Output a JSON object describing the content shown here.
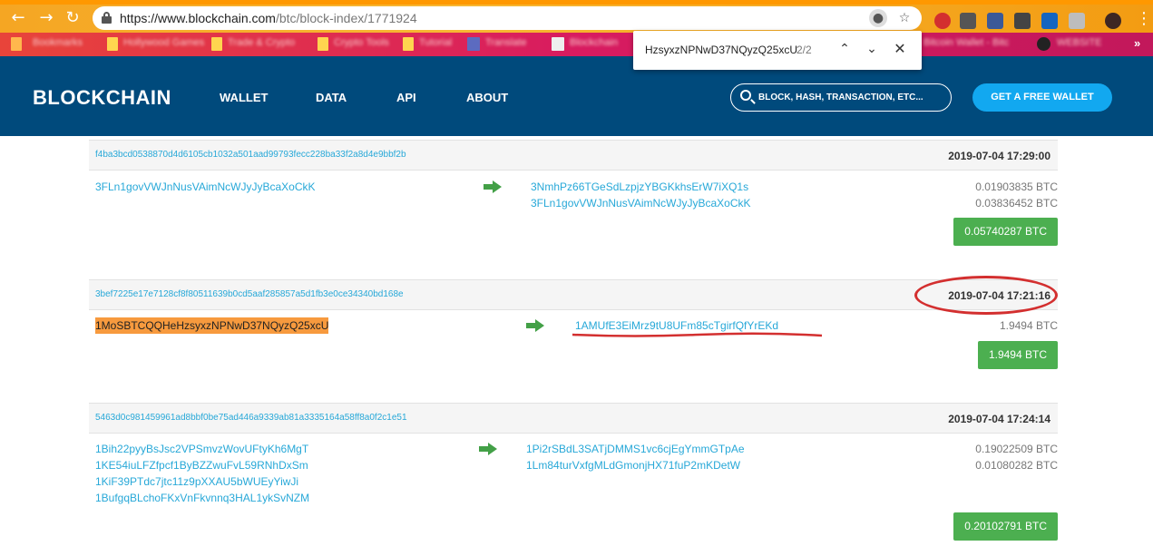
{
  "browser": {
    "url_main": "https://www.blockchain.com",
    "url_path": "/btc/block-index/1771924",
    "back_icon": "arrow-left-icon",
    "forward_icon": "arrow-right-icon",
    "reload_icon": "reload-icon",
    "star_icon": "star-icon",
    "menu_icon": "kebab-icon",
    "bookmarks": [
      "Bookmarks",
      "Hollywood Games",
      "Trade & Crypto",
      "Crypto Tools",
      "Tutorial",
      "Translate",
      "Blockchain",
      "Bitcoin Wallet - Bitc",
      "WEBSITE"
    ],
    "find": {
      "query": "HzsyxzNPNwD37NQyzQ25xcU",
      "count": "2/2"
    }
  },
  "header": {
    "logo": "BLOCKCHAIN",
    "nav": [
      "WALLET",
      "DATA",
      "API",
      "ABOUT"
    ],
    "search_placeholder": "BLOCK, HASH, TRANSACTION, ETC...",
    "cta": "GET A FREE WALLET"
  },
  "transactions": [
    {
      "hash": "f4ba3bcd0538870d4d6105cb1032a501aad99793fecc228ba33f2a8d4e9bbf2b",
      "time": "2019-07-04 17:29:00",
      "inputs": [
        "3FLn1govVWJnNusVAimNcWJyJyBcaXoCkK"
      ],
      "outputs": [
        "3NmhPz66TGeSdLzpjzYBGKkhsErW7iXQ1s",
        "3FLn1govVWJnNusVAimNcWJyJyBcaXoCkK"
      ],
      "amounts": [
        "0.01903835 BTC",
        "0.03836452 BTC"
      ],
      "total": "0.05740287 BTC"
    },
    {
      "hash": "3bef7225e17e7128cf8f80511639b0cd5aaf285857a5d1fb3e0ce34340bd168e",
      "time": "2019-07-04 17:21:16",
      "inputs": [
        "1MoSBTCQQHeHzsyxzNPNwD37NQyzQ25xcU"
      ],
      "outputs": [
        "1AMUfE3EiMrz9tU8UFm85cTgirfQfYrEKd"
      ],
      "amounts": [
        "1.9494 BTC"
      ],
      "total": "1.9494 BTC"
    },
    {
      "hash": "5463d0c981459961ad8bbf0be75ad446a9339ab81a3335164a58ff8a0f2c1e51",
      "time": "2019-07-04 17:24:14",
      "inputs": [
        "1Bih22pyyBsJsc2VPSmvzWovUFtyKh6MgT",
        "1KE54iuLFZfpcf1ByBZZwuFvL59RNhDxSm",
        "1KiF39PTdc7jtc11z9pXXAU5bWUEyYiwJi",
        "1BufgqBLchoFKxVnFkvnnq3HAL1ykSvNZM"
      ],
      "outputs": [
        "1Pi2rSBdL3SATjDMMS1vc6cjEgYmmGTpAe",
        "1Lm84turVxfgMLdGmonjHX71fuP2mKDetW"
      ],
      "amounts": [
        "0.19022509 BTC",
        "0.01080282 BTC"
      ],
      "total": "0.20102791 BTC"
    }
  ],
  "annotations": {
    "ellipse_color": "#d32f2f",
    "underline_color": "#d32f2f"
  }
}
